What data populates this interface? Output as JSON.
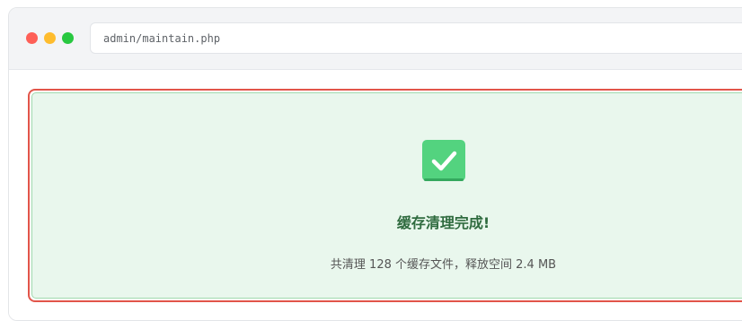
{
  "browser": {
    "url": "admin/maintain.php",
    "controls": [
      "close",
      "minimize",
      "maximize"
    ]
  },
  "alert": {
    "icon": "check-icon",
    "title": "缓存清理完成!",
    "description": "共清理 128 个缓存文件，释放空间 2.4 MB"
  },
  "colors": {
    "alert_border": "#e2554a",
    "alert_bg": "#e9f7ed",
    "check_bg": "#53d37f",
    "title_text": "#2f6b3f"
  }
}
